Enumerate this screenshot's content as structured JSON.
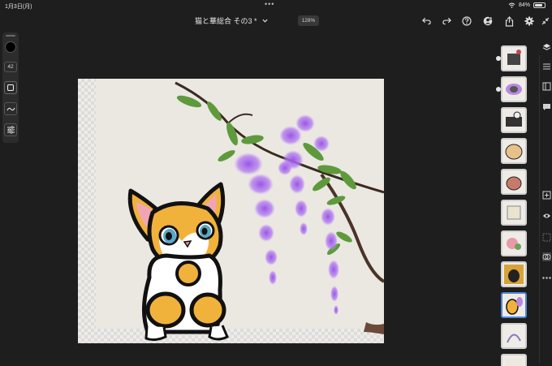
{
  "status_bar": {
    "time": "1月3日(月)",
    "battery": "84%",
    "battery_level": 0.84
  },
  "document": {
    "title": "猫と華総合 その3 *",
    "zoom": "128%"
  },
  "toolbar": {
    "icons": [
      "undo-icon",
      "redo-icon",
      "help-icon",
      "account-icon",
      "share-icon",
      "settings-icon",
      "collapse-icon"
    ]
  },
  "left_tools": {
    "brush_color": "#000000",
    "brush_size": "42",
    "items": [
      "color-swatch",
      "brush-size",
      "opacity",
      "smoothing-icon",
      "brush-settings-icon"
    ]
  },
  "layers": {
    "count": 11,
    "active_index": 8
  },
  "right_tools": {
    "icons": [
      "layers-icon",
      "adjustments-icon",
      "properties-icon",
      "comment-icon",
      "add-layer-icon",
      "visibility-icon",
      "mask-icon",
      "group-icon",
      "merge-icon",
      "more-icon"
    ]
  },
  "colors": {
    "background": "#1e1e1e",
    "panel": "#2c2c2c",
    "active_layer": "#4f86d8"
  }
}
